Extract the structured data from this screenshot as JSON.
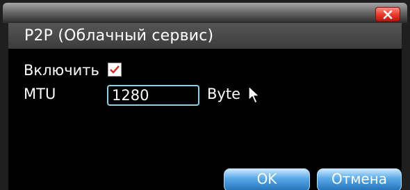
{
  "dialog": {
    "title": "P2P (Облачный сервис)",
    "close_icon": "close-x-icon"
  },
  "form": {
    "enable_label": "Включить",
    "enable_checked": true,
    "mtu_label": "MTU",
    "mtu_value": "1280",
    "mtu_unit": "Byte"
  },
  "buttons": {
    "ok_label": "OK",
    "cancel_label": "Отмена"
  },
  "colors": {
    "checkmark": "#d9251c",
    "input_border": "#8fd0e8",
    "button_blue": "#3b8fd6",
    "close_red": "#e8392a"
  }
}
